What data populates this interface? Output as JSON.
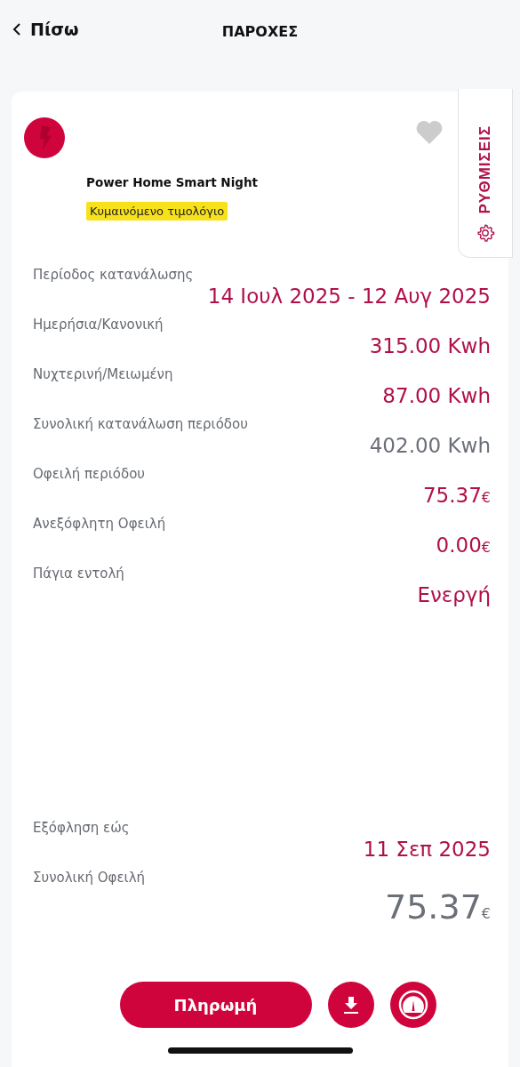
{
  "header": {
    "back": "Πίσω",
    "title": "ΠΑΡΟΧΕΣ"
  },
  "supply": {
    "plan": "Power Home Smart Night",
    "tag": "Κυμαινόμενο τιμολόγιο",
    "favorite": false,
    "settings": "ΡΥΘΜΙΣΕΙΣ"
  },
  "details": [
    {
      "label": "Περίοδος κατανάλωσης",
      "value": "14 Ιουλ 2025 - 12 Αυγ 2025",
      "kind": "accent"
    },
    {
      "label": "Ημερήσια/Κανονική",
      "value": "315.00 Kwh",
      "kind": "accent"
    },
    {
      "label": "Νυχτερινή/Μειωμένη",
      "value": "87.00 Kwh",
      "kind": "accent"
    },
    {
      "label": "Συνολική κατανάλωση περιόδου",
      "value": "402.00 Kwh",
      "kind": "plain"
    },
    {
      "label": "Οφειλή περιόδου",
      "value": "75.37",
      "unit": "€",
      "kind": "accent"
    },
    {
      "label": "Ανεξόφλητη Οφειλή",
      "value": "0.00",
      "unit": "€",
      "kind": "accent"
    },
    {
      "label": "Πάγια εντολή",
      "value": "Ενεργή",
      "kind": "accent"
    }
  ],
  "due": {
    "label": "Εξόφληση εώς",
    "value": "11 Σεπ 2025"
  },
  "total": {
    "label": "Συνολική Οφειλή",
    "value": "75.37",
    "unit": "€"
  },
  "pay_button": "Πληρωμή"
}
